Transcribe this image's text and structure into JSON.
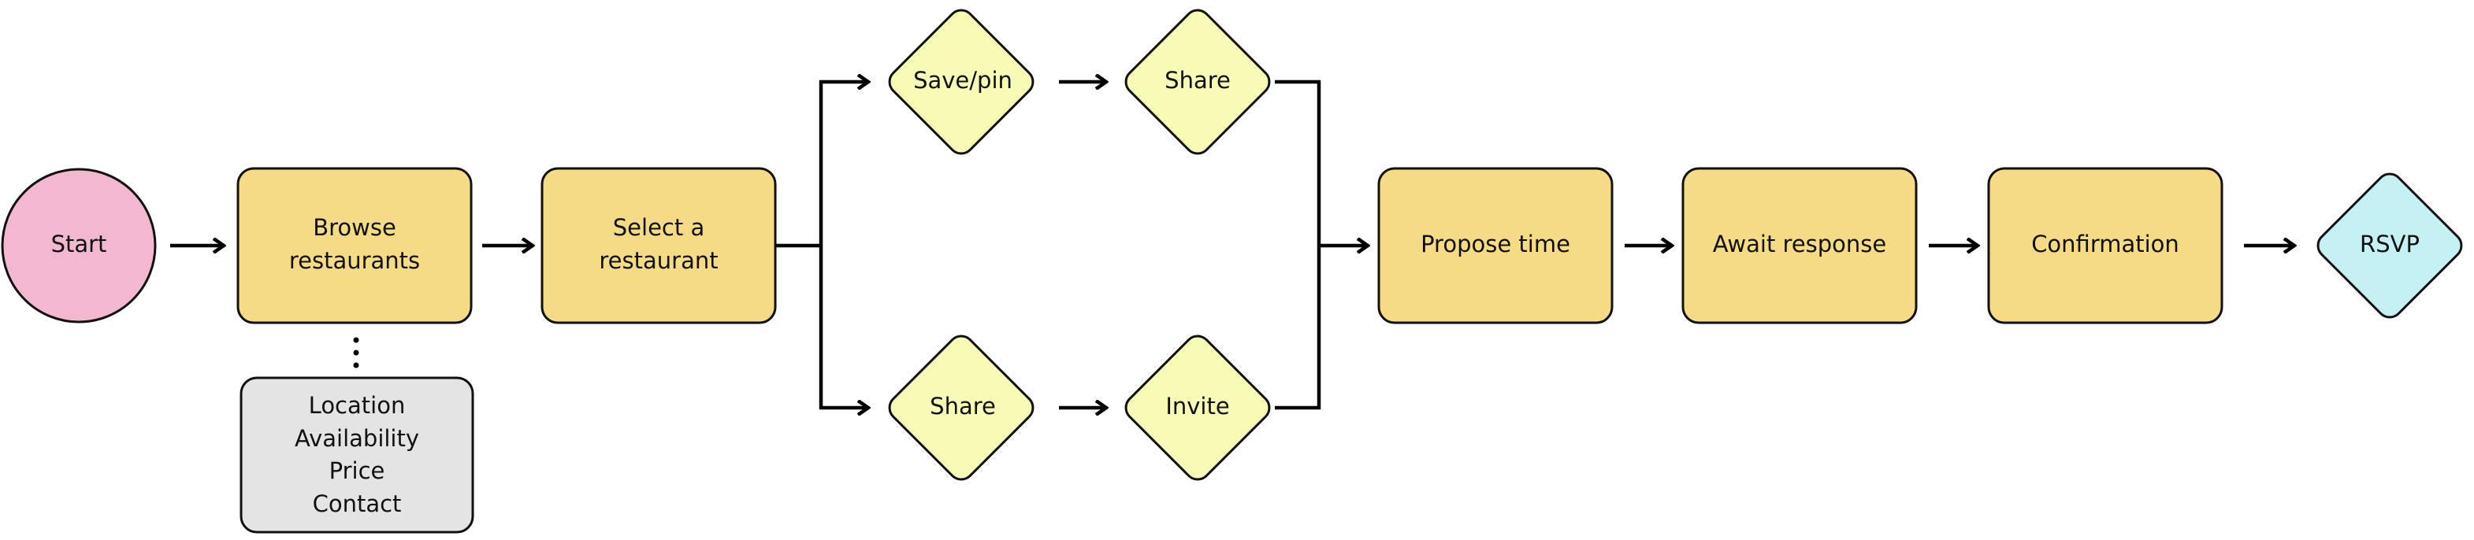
{
  "colors": {
    "start": "#F2B8CF",
    "process": "#F6DB85",
    "decision": "#F8FBB6",
    "note": "#E4E4E4",
    "end": "#C6F1F4",
    "line": "#000000"
  },
  "nodes": {
    "start": {
      "label": "Start",
      "shape": "circle"
    },
    "browse": {
      "lines": [
        "Browse",
        "restaurants"
      ],
      "shape": "rounded-rect"
    },
    "browse_details": {
      "lines": [
        "Location",
        "Availability",
        "Price",
        "Contact"
      ],
      "shape": "rounded-rect"
    },
    "select": {
      "lines": [
        "Select a",
        "restaurant"
      ],
      "shape": "rounded-rect"
    },
    "save_pin": {
      "label": "Save/pin",
      "shape": "diamond"
    },
    "share_top": {
      "label": "Share",
      "shape": "diamond"
    },
    "share_bottom": {
      "label": "Share",
      "shape": "diamond"
    },
    "invite": {
      "label": "Invite",
      "shape": "diamond"
    },
    "propose": {
      "label": "Propose time",
      "shape": "rounded-rect"
    },
    "await": {
      "label": "Await response",
      "shape": "rounded-rect"
    },
    "confirmation": {
      "label": "Confirmation",
      "shape": "rounded-rect"
    },
    "rsvp": {
      "label": "RSVP",
      "shape": "diamond"
    }
  },
  "edges": [
    [
      "start",
      "browse"
    ],
    [
      "browse",
      "select"
    ],
    [
      "select",
      "save_pin"
    ],
    [
      "select",
      "share_bottom"
    ],
    [
      "save_pin",
      "share_top"
    ],
    [
      "share_bottom",
      "invite"
    ],
    [
      "share_top",
      "propose"
    ],
    [
      "invite",
      "propose"
    ],
    [
      "propose",
      "await"
    ],
    [
      "await",
      "confirmation"
    ],
    [
      "confirmation",
      "rsvp"
    ],
    [
      "browse",
      "browse_details"
    ]
  ]
}
